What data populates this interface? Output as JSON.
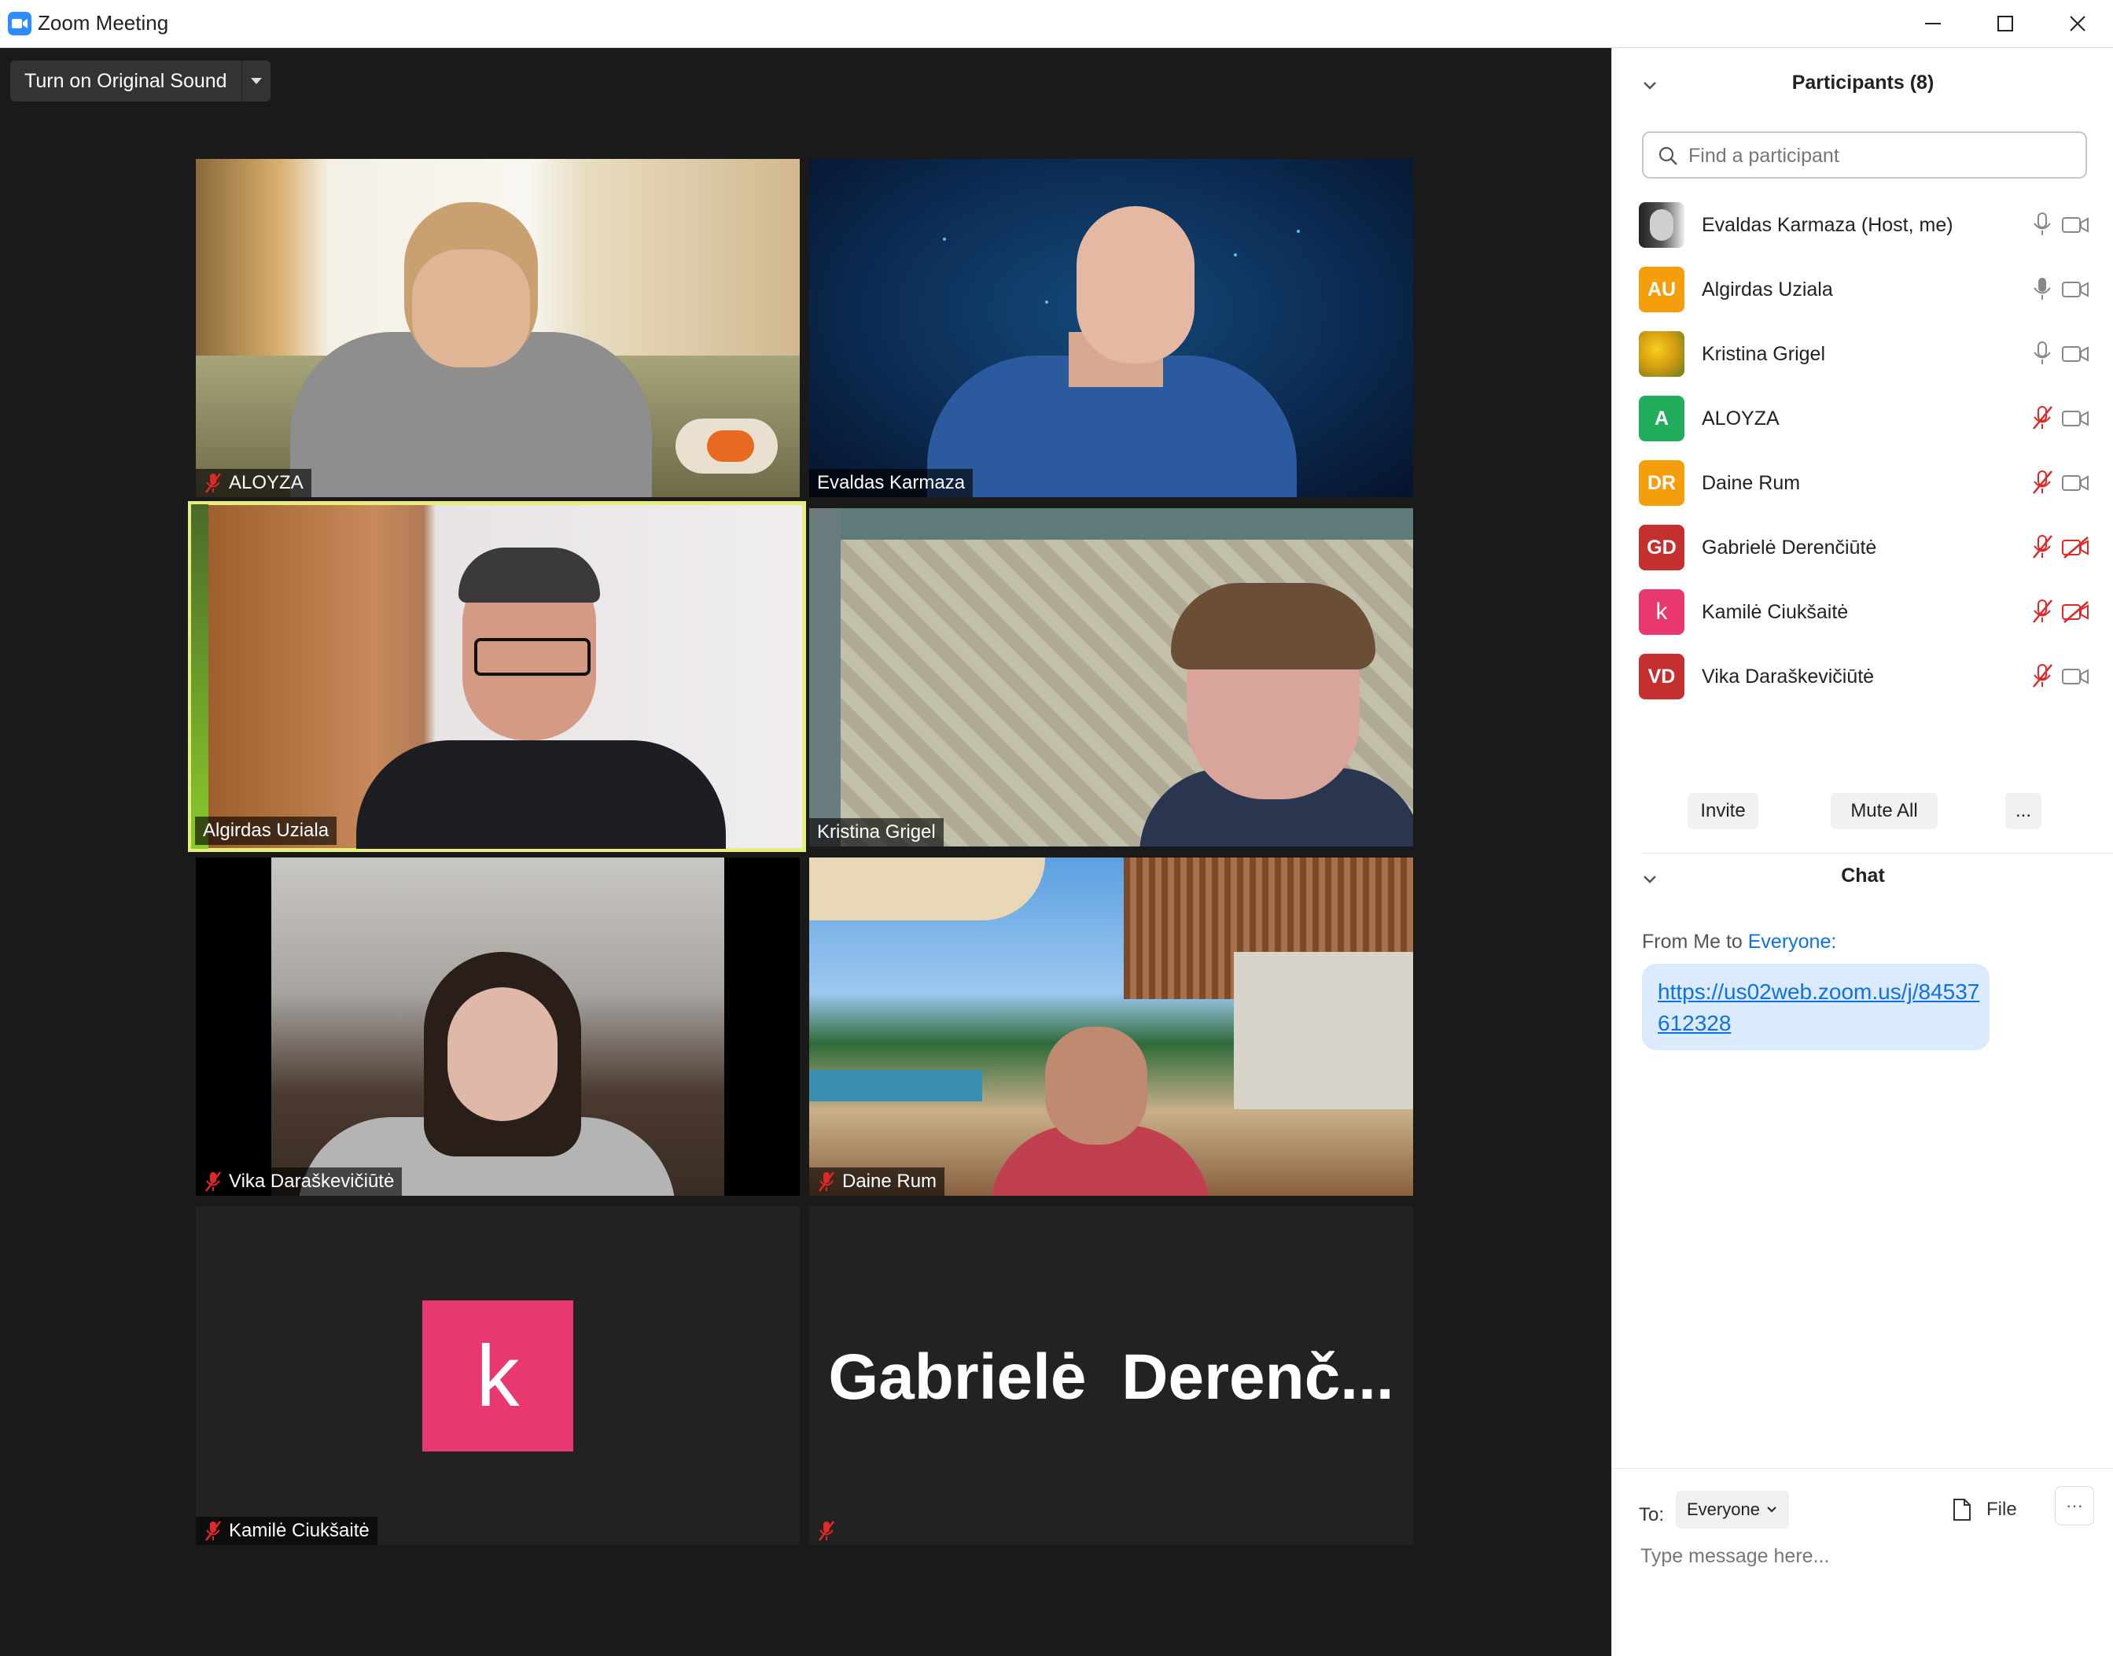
{
  "window": {
    "title": "Zoom Meeting"
  },
  "toolbar": {
    "original_sound_label": "Turn on Original Sound"
  },
  "video_tiles": [
    {
      "name": "ALOYZA",
      "muted": true
    },
    {
      "name": "Evaldas Karmaza",
      "muted": false
    },
    {
      "name": "Algirdas Uziala",
      "muted": false,
      "active_speaker": true
    },
    {
      "name": "Kristina Grigel",
      "muted": false
    },
    {
      "name": "Vika Daraškevičiūtė",
      "muted": true
    },
    {
      "name": "Daine Rum",
      "muted": true
    },
    {
      "name": "Kamilė Ciukšaitė",
      "muted": true,
      "avatar_letter": "k",
      "avatar_color": "#e8386f"
    },
    {
      "display_text": "Gabrielė  Derenč...",
      "muted": true
    }
  ],
  "participants": {
    "title": "Participants (8)",
    "search_placeholder": "Find a participant",
    "list": [
      {
        "name": "Evaldas Karmaza (Host, me)",
        "avatar": "photo",
        "mic": "on",
        "video": "on"
      },
      {
        "name": "Algirdas Uziala",
        "initials": "AU",
        "color": "#f59e0b",
        "mic": "on",
        "video": "on"
      },
      {
        "name": "Kristina Grigel",
        "avatar": "photo",
        "mic": "on",
        "video": "on"
      },
      {
        "name": "ALOYZA",
        "initials": "A",
        "color": "#22ad5c",
        "mic": "muted",
        "video": "on"
      },
      {
        "name": "Daine Rum",
        "initials": "DR",
        "color": "#f59e0b",
        "mic": "muted",
        "video": "on"
      },
      {
        "name": "Gabrielė Derenčiūtė",
        "initials": "GD",
        "color": "#c43030",
        "mic": "muted",
        "video": "off"
      },
      {
        "name": "Kamilė Ciukšaitė",
        "initials": "k",
        "color": "#e8386f",
        "mic": "muted",
        "video": "off"
      },
      {
        "name": "Vika Daraškevičiūtė",
        "initials": "VD",
        "color": "#c43030",
        "mic": "muted",
        "video": "on"
      }
    ],
    "buttons": {
      "invite": "Invite",
      "mute_all": "Mute All",
      "more": "..."
    }
  },
  "chat": {
    "title": "Chat",
    "from_prefix": "From Me to ",
    "from_target": "Everyone:",
    "message_link": "https://us02web.zoom.us/j/84537612328",
    "to_label": "To:",
    "to_value": "Everyone",
    "file_label": "File",
    "more": "···",
    "input_placeholder": "Type message here..."
  },
  "colors": {
    "accent": "#0e71eb",
    "active_speaker": "#e7ef7a",
    "muted_red": "#e02828"
  }
}
